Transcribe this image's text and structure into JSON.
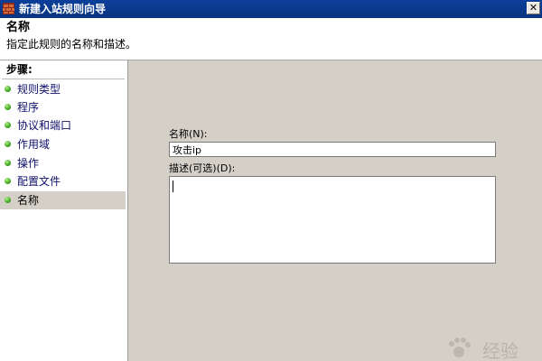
{
  "window": {
    "title": "新建入站规则向导",
    "close_symbol": "✕"
  },
  "header": {
    "title": "名称",
    "description": "指定此规则的名称和描述。"
  },
  "steps": {
    "title": "步骤:",
    "items": [
      {
        "label": "规则类型",
        "active": false
      },
      {
        "label": "程序",
        "active": false
      },
      {
        "label": "协议和端口",
        "active": false
      },
      {
        "label": "作用域",
        "active": false
      },
      {
        "label": "操作",
        "active": false
      },
      {
        "label": "配置文件",
        "active": false
      },
      {
        "label": "名称",
        "active": true
      }
    ]
  },
  "form": {
    "name_label": "名称(N):",
    "name_value": "攻击ip",
    "description_label": "描述(可选)(D):",
    "description_value": ""
  },
  "watermark": {
    "text": "经验"
  },
  "icons": {
    "title_icon": "firewall-icon",
    "step_bullet": "green-dot-icon"
  }
}
